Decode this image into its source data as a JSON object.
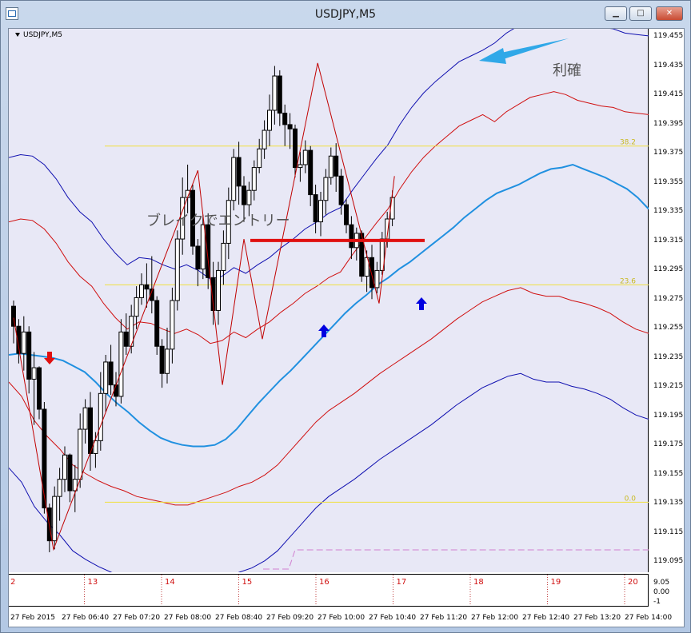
{
  "window": {
    "title": "USDJPY,M5"
  },
  "chart": {
    "symbol_label": "USDJPY,M5",
    "annotations": {
      "entry": "ブレイクでエントリー",
      "take_profit": "利確"
    },
    "fib_labels": [
      "38.2",
      "23.6",
      "0.0"
    ],
    "colors": {
      "background": "#e8e8f6",
      "bollinger_outer": "#1010b0",
      "bollinger_inner": "#d01010",
      "ma": "#2090e0",
      "zigzag": "#c00000",
      "fib": "#f0e040",
      "arrow_buy": "#0000e0",
      "arrow_sell": "#e01010",
      "break_line": "#e01010"
    }
  },
  "price_axis": {
    "labels": [
      "119.455",
      "119.435",
      "119.415",
      "119.395",
      "119.375",
      "119.355",
      "119.335",
      "119.315",
      "119.295",
      "119.275",
      "119.255",
      "119.235",
      "119.215",
      "119.195",
      "119.175",
      "119.155",
      "119.135",
      "119.115",
      "119.095"
    ]
  },
  "sub_axis": {
    "labels": [
      "9.05",
      "0.00",
      "-1"
    ],
    "day_labels": [
      "2",
      "13",
      "14",
      "15",
      "16",
      "17",
      "18",
      "19",
      "20"
    ]
  },
  "time_axis": {
    "labels": [
      "27 Feb 2015",
      "27 Feb 06:40",
      "27 Feb 07:20",
      "27 Feb 08:00",
      "27 Feb 08:40",
      "27 Feb 09:20",
      "27 Feb 10:00",
      "27 Feb 10:40",
      "27 Feb 11:20",
      "27 Feb 12:00",
      "27 Feb 12:40",
      "27 Feb 13:20",
      "27 Feb 14:00"
    ]
  },
  "chart_data": {
    "type": "candlestick",
    "price_range": [
      119.085,
      119.465
    ],
    "candles": [
      [
        119.271,
        119.275,
        119.245,
        119.257
      ],
      [
        119.257,
        119.262,
        119.231,
        119.238
      ],
      [
        119.238,
        119.264,
        119.226,
        119.253
      ],
      [
        119.253,
        119.257,
        119.21,
        119.22
      ],
      [
        119.22,
        119.239,
        119.188,
        119.228
      ],
      [
        119.228,
        119.229,
        119.192,
        119.199
      ],
      [
        119.199,
        119.204,
        119.126,
        119.13
      ],
      [
        119.13,
        119.133,
        119.099,
        119.107
      ],
      [
        119.107,
        119.145,
        119.101,
        119.138
      ],
      [
        119.138,
        119.158,
        119.121,
        119.15
      ],
      [
        119.15,
        119.173,
        119.141,
        119.167
      ],
      [
        119.167,
        119.168,
        119.134,
        119.142
      ],
      [
        119.142,
        119.16,
        119.127,
        119.15
      ],
      [
        119.15,
        119.196,
        119.144,
        119.185
      ],
      [
        119.185,
        119.206,
        119.175,
        119.2
      ],
      [
        119.2,
        119.211,
        119.156,
        119.168
      ],
      [
        119.168,
        119.183,
        119.158,
        119.177
      ],
      [
        119.177,
        119.225,
        119.17,
        119.21
      ],
      [
        119.21,
        119.237,
        119.197,
        119.232
      ],
      [
        119.232,
        119.244,
        119.209,
        119.216
      ],
      [
        119.216,
        119.225,
        119.201,
        119.208
      ],
      [
        119.208,
        119.262,
        119.203,
        119.253
      ],
      [
        119.253,
        119.266,
        119.237,
        119.243
      ],
      [
        119.243,
        119.272,
        119.238,
        119.264
      ],
      [
        119.264,
        119.285,
        119.255,
        119.277
      ],
      [
        119.277,
        119.294,
        119.272,
        119.286
      ],
      [
        119.286,
        119.301,
        119.27,
        119.283
      ],
      [
        119.283,
        119.306,
        119.266,
        119.275
      ],
      [
        119.275,
        119.278,
        119.237,
        119.243
      ],
      [
        119.243,
        119.248,
        119.214,
        119.224
      ],
      [
        119.224,
        119.256,
        119.217,
        119.241
      ],
      [
        119.241,
        119.284,
        119.231,
        119.275
      ],
      [
        119.275,
        119.324,
        119.268,
        119.318
      ],
      [
        119.318,
        119.361,
        119.307,
        119.347
      ],
      [
        119.347,
        119.37,
        119.336,
        119.352
      ],
      [
        119.352,
        119.356,
        119.307,
        119.313
      ],
      [
        119.313,
        119.318,
        119.285,
        119.297
      ],
      [
        119.297,
        119.335,
        119.29,
        119.328
      ],
      [
        119.328,
        119.336,
        119.283,
        119.291
      ],
      [
        119.291,
        119.302,
        119.258,
        119.268
      ],
      [
        119.268,
        119.302,
        119.258,
        119.296
      ],
      [
        119.296,
        119.324,
        119.286,
        119.315
      ],
      [
        119.315,
        119.354,
        119.304,
        119.345
      ],
      [
        119.345,
        119.381,
        119.338,
        119.375
      ],
      [
        119.375,
        119.386,
        119.342,
        119.355
      ],
      [
        119.355,
        119.362,
        119.33,
        119.342
      ],
      [
        119.342,
        119.358,
        119.334,
        119.352
      ],
      [
        119.352,
        119.373,
        119.345,
        119.368
      ],
      [
        119.368,
        119.388,
        119.364,
        119.381
      ],
      [
        119.381,
        119.401,
        119.374,
        119.394
      ],
      [
        119.394,
        119.419,
        119.383,
        119.408
      ],
      [
        119.408,
        119.439,
        119.398,
        119.432
      ],
      [
        119.432,
        119.436,
        119.397,
        119.406
      ],
      [
        119.406,
        119.412,
        119.383,
        119.398
      ],
      [
        119.398,
        119.406,
        119.381,
        119.395
      ],
      [
        119.395,
        119.398,
        119.361,
        119.368
      ],
      [
        119.368,
        119.379,
        119.358,
        119.37
      ],
      [
        119.37,
        119.387,
        119.364,
        119.38
      ],
      [
        119.38,
        119.383,
        119.341,
        119.349
      ],
      [
        119.349,
        119.356,
        119.322,
        119.33
      ],
      [
        119.33,
        119.351,
        119.32,
        119.345
      ],
      [
        119.345,
        119.367,
        119.335,
        119.361
      ],
      [
        119.361,
        119.382,
        119.356,
        119.376
      ],
      [
        119.376,
        119.385,
        119.351,
        119.362
      ],
      [
        119.362,
        119.367,
        119.335,
        119.342
      ],
      [
        119.342,
        119.346,
        119.322,
        119.328
      ],
      [
        119.328,
        119.334,
        119.304,
        119.312
      ],
      [
        119.312,
        119.326,
        119.303,
        119.322
      ],
      [
        119.322,
        119.324,
        119.288,
        119.292
      ],
      [
        119.292,
        119.31,
        119.281,
        119.305
      ],
      [
        119.305,
        119.314,
        119.276,
        119.284
      ],
      [
        119.284,
        119.302,
        119.28,
        119.296
      ],
      [
        119.296,
        119.323,
        119.293,
        119.318
      ],
      [
        119.318,
        119.337,
        119.312,
        119.332
      ],
      [
        119.332,
        119.352,
        119.327,
        119.347
      ]
    ],
    "upper_outer": [
      119.375,
      119.377,
      119.376,
      119.37,
      119.36,
      119.347,
      119.337,
      119.33,
      119.318,
      119.308,
      119.3,
      119.305,
      119.304,
      119.3,
      119.297,
      119.3,
      119.296,
      119.29,
      119.292,
      119.298,
      119.294,
      119.3,
      119.305,
      119.312,
      119.318,
      119.325,
      119.33,
      119.336,
      119.34,
      119.352,
      119.363,
      119.374,
      119.384,
      119.398,
      119.41,
      119.42,
      119.428,
      119.435,
      119.442,
      119.446,
      119.45,
      119.455,
      119.462,
      119.467,
      119.472,
      119.474,
      119.476,
      119.474,
      119.47,
      119.468,
      119.466,
      119.465,
      119.462,
      119.461,
      119.46
    ],
    "lower_outer": [
      119.158,
      119.148,
      119.131,
      119.12,
      119.111,
      119.1,
      119.094,
      119.089,
      119.085,
      119.082,
      119.078,
      119.076,
      119.074,
      119.072,
      119.072,
      119.075,
      119.078,
      119.081,
      119.085,
      119.088,
      119.093,
      119.1,
      119.11,
      119.12,
      119.13,
      119.138,
      119.144,
      119.15,
      119.157,
      119.164,
      119.17,
      119.176,
      119.182,
      119.188,
      119.195,
      119.202,
      119.208,
      119.214,
      119.218,
      119.222,
      119.224,
      119.22,
      119.218,
      119.218,
      119.215,
      119.213,
      119.21,
      119.206,
      119.2,
      119.195,
      119.192
    ],
    "ma": [
      119.237,
      119.238,
      119.237,
      119.236,
      119.235,
      119.233,
      119.229,
      119.225,
      119.218,
      119.21,
      119.203,
      119.197,
      119.19,
      119.184,
      119.179,
      119.176,
      119.174,
      119.173,
      119.173,
      119.174,
      119.178,
      119.185,
      119.194,
      119.203,
      119.211,
      119.219,
      119.226,
      119.234,
      119.242,
      119.25,
      119.258,
      119.266,
      119.273,
      119.279,
      119.286,
      119.291,
      119.297,
      119.302,
      119.308,
      119.314,
      119.32,
      119.326,
      119.333,
      119.339,
      119.345,
      119.35,
      119.353,
      119.356,
      119.36,
      119.364,
      119.367,
      119.368,
      119.37,
      119.367,
      119.364,
      119.361,
      119.357,
      119.353,
      119.347,
      119.339
    ],
    "zigzag": [
      [
        0,
        119.263
      ],
      [
        13,
        119.101
      ],
      [
        60,
        119.366
      ],
      [
        68,
        119.216
      ],
      [
        75,
        119.318
      ],
      [
        81,
        119.248
      ],
      [
        99,
        119.441
      ],
      [
        119,
        119.273
      ],
      [
        124,
        119.362
      ]
    ],
    "break_level": 119.317,
    "fib_levels": [
      119.383,
      119.286,
      119.134
    ]
  }
}
